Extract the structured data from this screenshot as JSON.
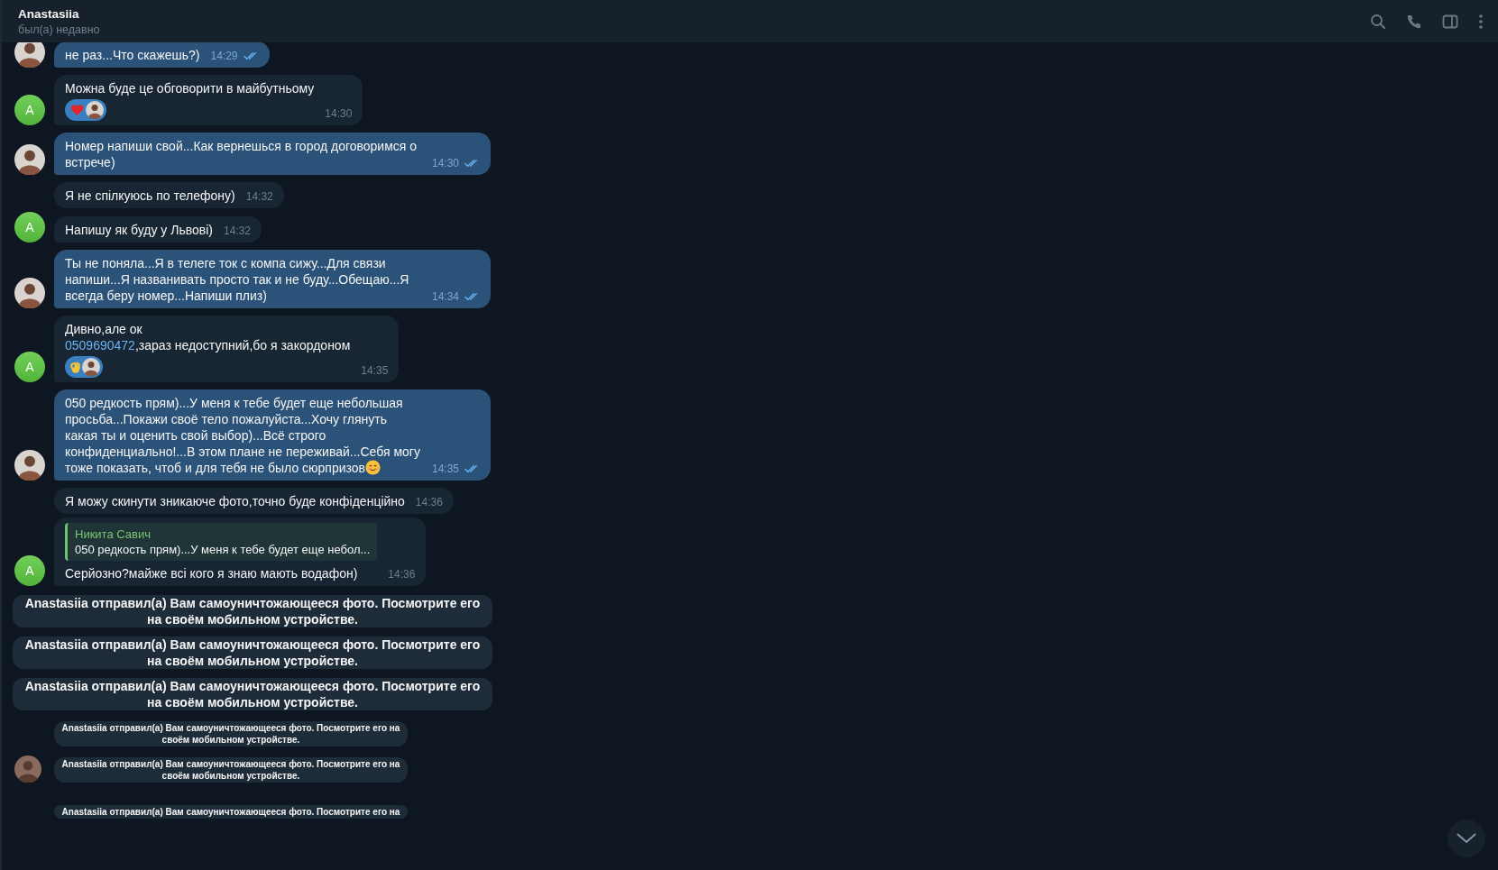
{
  "header": {
    "title": "Anastasiia",
    "status": "был(а) недавно"
  },
  "messages": [
    {
      "kind": "out",
      "segments": [
        {
          "kind": "text",
          "text": "не раз...Что скажешь?)"
        }
      ],
      "time": "14:29",
      "read": true,
      "avatar": true
    },
    {
      "kind": "in",
      "segments": [
        {
          "kind": "text",
          "text": "Можна буде це обговорити в майбутньому"
        }
      ],
      "reactions": [
        {
          "kind": "heart"
        }
      ],
      "time": "14:30",
      "avatar": true,
      "avatar_letter": "A"
    },
    {
      "kind": "out",
      "segments": [
        {
          "kind": "text",
          "text": "Номер напиши свой...Как вернешься в город договоримся о встрече)"
        }
      ],
      "time": "14:30",
      "read": true,
      "avatar": true
    },
    {
      "kind": "in",
      "segments": [
        {
          "kind": "text",
          "text": "Я не спілкуюсь по телефону)"
        }
      ],
      "time": "14:32",
      "avatar": false
    },
    {
      "kind": "in",
      "segments": [
        {
          "kind": "text",
          "text": "Напишу як буду у Львові)"
        }
      ],
      "time": "14:32",
      "avatar": true,
      "avatar_letter": "A"
    },
    {
      "kind": "out",
      "segments": [
        {
          "kind": "text",
          "text": "Ты не поняла...Я в телеге ток с компа сижу...Для связи напиши...Я названивать просто так и не буду...Обещаю...Я всегда беру номер...Напиши плиз)"
        }
      ],
      "time": "14:34",
      "read": true,
      "avatar": true
    },
    {
      "kind": "in",
      "segments": [
        {
          "kind": "text",
          "text": "Дивно,але ок"
        },
        {
          "kind": "break"
        },
        {
          "kind": "link",
          "text": "0509690472"
        },
        {
          "kind": "text",
          "text": ",зараз недоступний,бо я закордоном"
        }
      ],
      "reactions": [
        {
          "kind": "ok"
        }
      ],
      "time": "14:35",
      "avatar": true,
      "avatar_letter": "A"
    },
    {
      "kind": "out",
      "segments": [
        {
          "kind": "text",
          "text": "050 редкость прям)...У меня к тебе будет еще небольшая просьба...Покажи своё тело пожалуйста...Хочу глянуть какая ты и оценить свой выбор)...Всё строго конфиденциально!...В этом плане не переживай...Себя могу тоже показать, чтоб и для тебя не было сюрпризов"
        },
        {
          "kind": "smiley"
        }
      ],
      "time": "14:35",
      "read": true,
      "avatar": true
    },
    {
      "kind": "in",
      "segments": [
        {
          "kind": "text",
          "text": "Я можу скинути зникаюче фото,точно буде конфіденційно"
        }
      ],
      "time": "14:36",
      "avatar": false
    },
    {
      "kind": "in",
      "reply": {
        "name": "Никита Савич",
        "text": "050 редкость прям)...У меня к тебе будет еще небол..."
      },
      "segments": [
        {
          "kind": "text",
          "text": "Серйозно?майже всі кого я знаю мають водафон)"
        }
      ],
      "time": "14:36",
      "avatar": true,
      "avatar_letter": "A"
    },
    {
      "kind": "service",
      "compact": false,
      "text": "Anastasiia отправил(а) Вам самоуничтожающееся фото. Посмотрите его на своём мобильном устройстве."
    },
    {
      "kind": "service",
      "compact": false,
      "text": "Anastasiia отправил(а) Вам самоуничтожающееся фото. Посмотрите его на своём мобильном устройстве."
    },
    {
      "kind": "service",
      "compact": false,
      "text": "Anastasiia отправил(а) Вам самоуничтожающееся фото. Посмотрите его на своём мобильном устройстве."
    },
    {
      "kind": "service",
      "compact": true,
      "text": "Anastasiia отправил(а) Вам самоуничтожающееся фото. Посмотрите его на своём мобильном устройстве.",
      "avatar": false
    },
    {
      "kind": "service",
      "compact": true,
      "text": "Anastasiia отправил(а) Вам самоуничтожающееся фото. Посмотрите его на своём мобильном устройстве.",
      "avatar": true
    },
    {
      "kind": "service",
      "compact": true,
      "text": "Anastasiia отправил(а) Вам самоуничтожающееся фото. Посмотрите его на",
      "avatar": false
    }
  ]
}
